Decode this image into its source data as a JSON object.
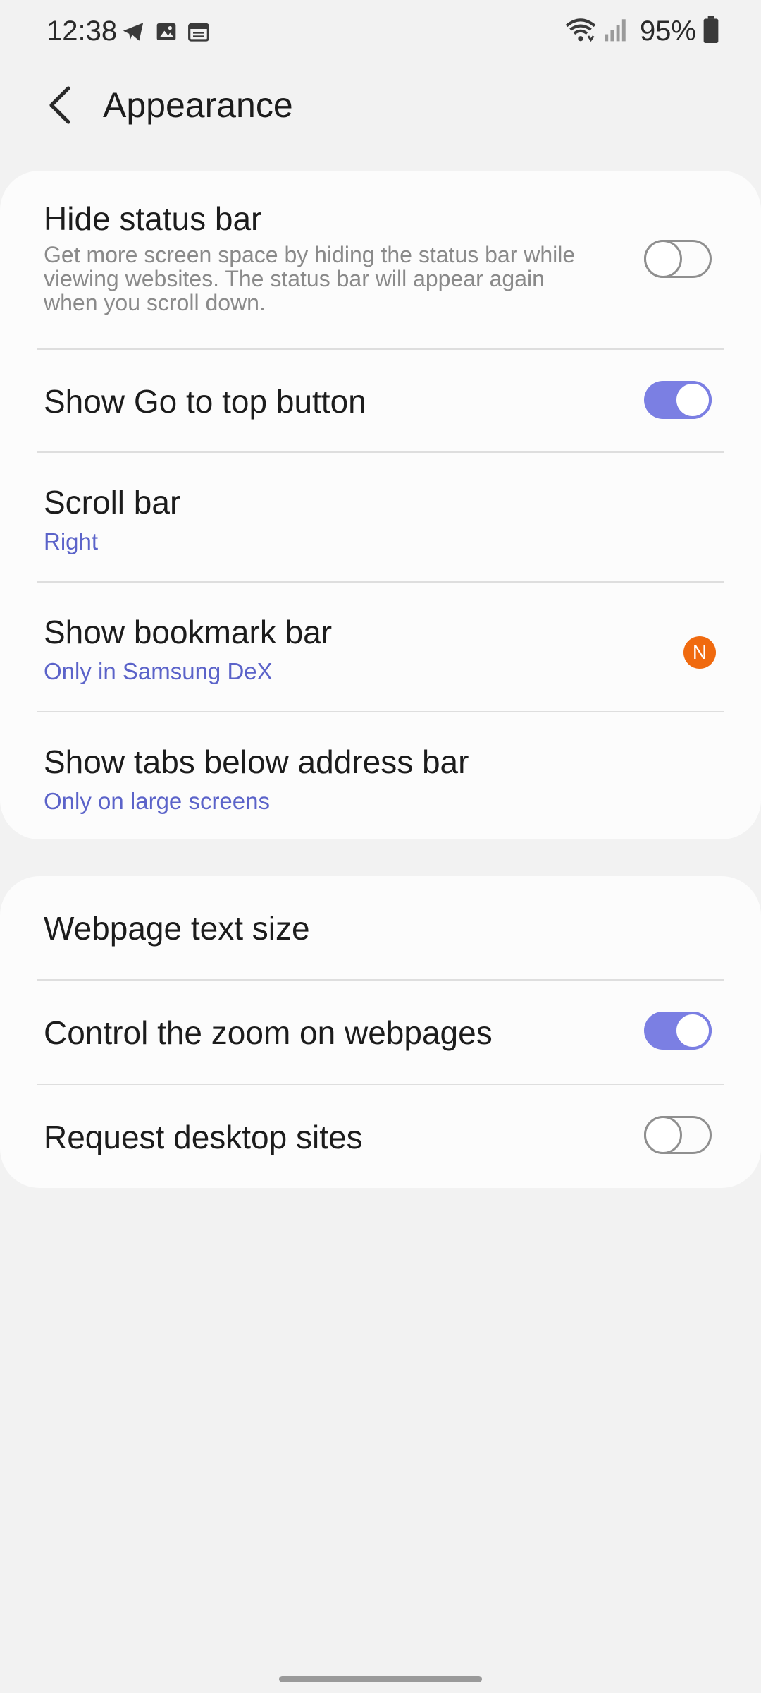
{
  "status_bar": {
    "time": "12:38",
    "icons_left": [
      "telegram-icon",
      "image-icon",
      "calendar-icon"
    ],
    "icons_right": [
      "wifi-icon",
      "signal-icon",
      "battery-icon"
    ],
    "battery": "95%"
  },
  "header": {
    "title": "Appearance",
    "back_icon": "chevron-left-icon"
  },
  "section1": {
    "hide_status_bar": {
      "title": "Hide status bar",
      "description": "Get more screen space by hiding the status bar while viewing websites. The status bar will appear again when you scroll down.",
      "toggle": "off"
    },
    "go_to_top": {
      "title": "Show Go to top button",
      "toggle": "on"
    },
    "scroll_bar": {
      "title": "Scroll bar",
      "value": "Right"
    },
    "bookmark_bar": {
      "title": "Show bookmark bar",
      "value": "Only in Samsung DeX",
      "badge": "N"
    },
    "tabs_below": {
      "title": "Show tabs below address bar",
      "value": "Only on large screens"
    }
  },
  "section2": {
    "text_size": {
      "title": "Webpage text size"
    },
    "zoom": {
      "title": "Control the zoom on webpages",
      "toggle": "on"
    },
    "desktop_sites": {
      "title": "Request desktop sites",
      "toggle": "off"
    }
  },
  "colors": {
    "accent": "#7b7fe3",
    "sub_text": "#5b63c9",
    "badge": "#f06a0f",
    "background": "#f2f2f2",
    "card": "#fcfcfc"
  }
}
